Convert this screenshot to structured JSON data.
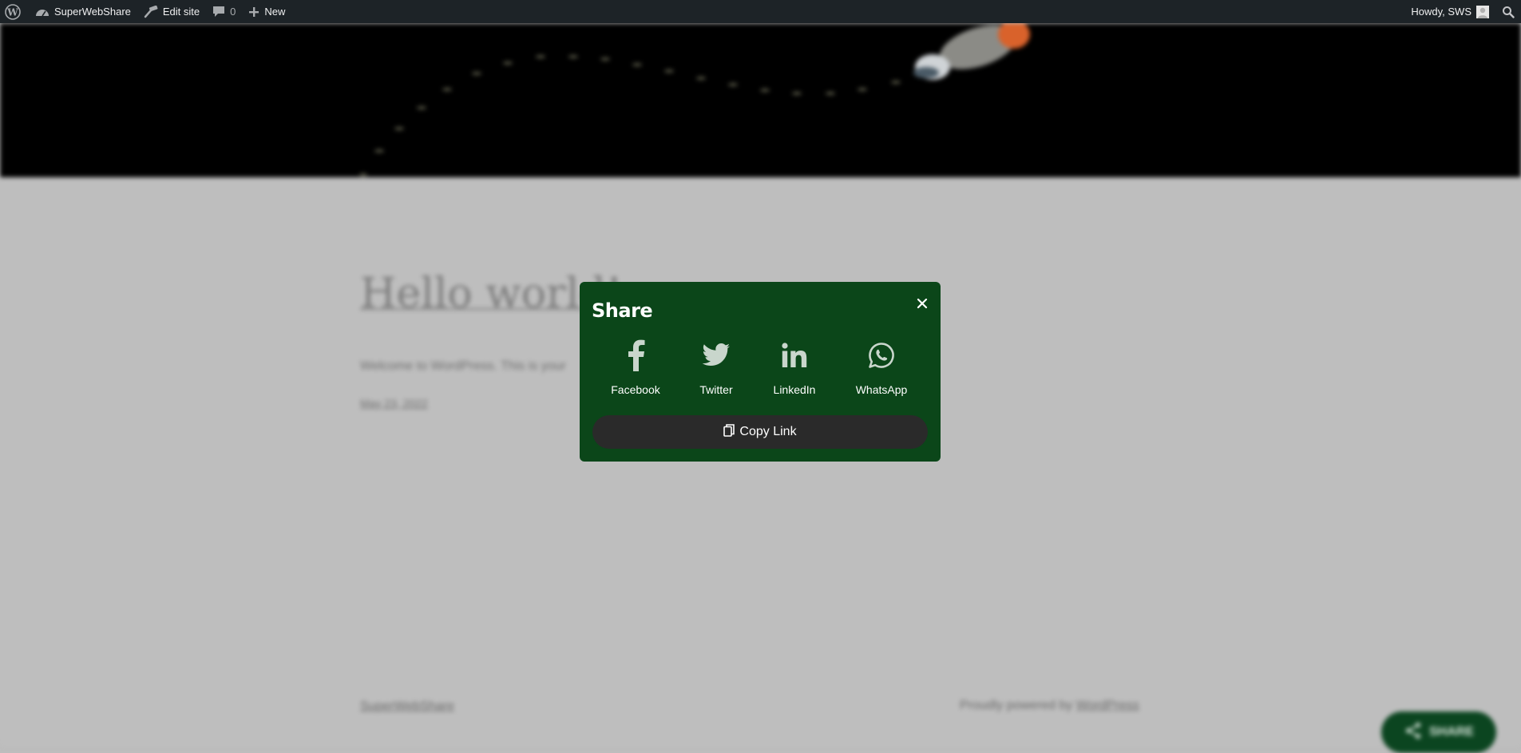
{
  "admin_bar": {
    "site_name": "SuperWebShare",
    "edit_site": "Edit site",
    "comments_count": "0",
    "new_label": "New",
    "greeting": "Howdy, SWS"
  },
  "page": {
    "post_title": "Hello world!",
    "post_excerpt": "Welcome to WordPress. This is your",
    "post_date": "May 23, 2022",
    "footer_site": "SuperWebShare",
    "footer_powered_prefix": "Proudly powered by",
    "footer_powered_link": "WordPress",
    "fab_label": "SHARE"
  },
  "share_modal": {
    "title": "Share",
    "options": [
      {
        "label": "Facebook",
        "icon": "facebook-icon"
      },
      {
        "label": "Twitter",
        "icon": "twitter-icon"
      },
      {
        "label": "LinkedIn",
        "icon": "linkedin-icon"
      },
      {
        "label": "WhatsApp",
        "icon": "whatsapp-icon"
      }
    ],
    "copy_link_label": "Copy Link"
  },
  "colors": {
    "admin_bar_bg": "#1d2327",
    "modal_bg": "#0b4619",
    "copy_button_bg": "#2a2a2a",
    "icon_muted": "#c9d6cc",
    "page_overlay": "#bdbdbd"
  }
}
